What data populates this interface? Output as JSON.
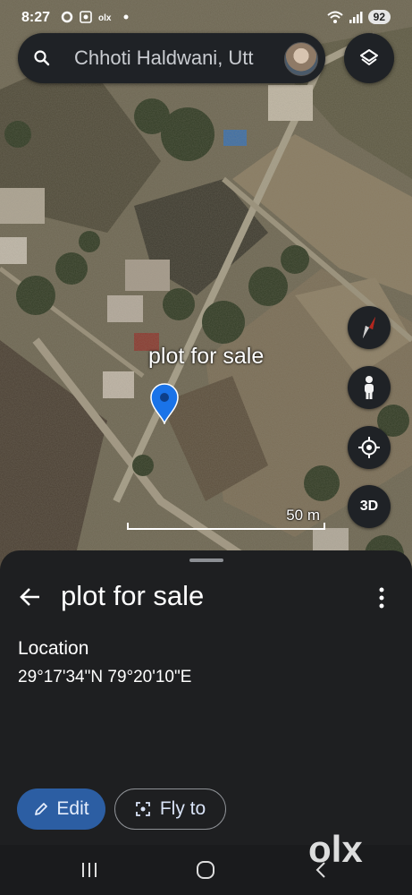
{
  "status_bar": {
    "time": "8:27",
    "battery": "92"
  },
  "search": {
    "text": "Chhoti Haldwani, Utt"
  },
  "map": {
    "pin_label": "plot for sale",
    "scale_label": "50 m",
    "three_d_label": "3D",
    "pin_color": "#1a73e8"
  },
  "sheet": {
    "title": "plot for sale",
    "location_label": "Location",
    "coordinates": "29°17'34\"N 79°20'10\"E",
    "edit_label": "Edit",
    "fly_to_label": "Fly to"
  },
  "colors": {
    "primary_button": "#2c5ea3",
    "sheet_bg": "#1e1f21"
  },
  "watermark": "olx"
}
